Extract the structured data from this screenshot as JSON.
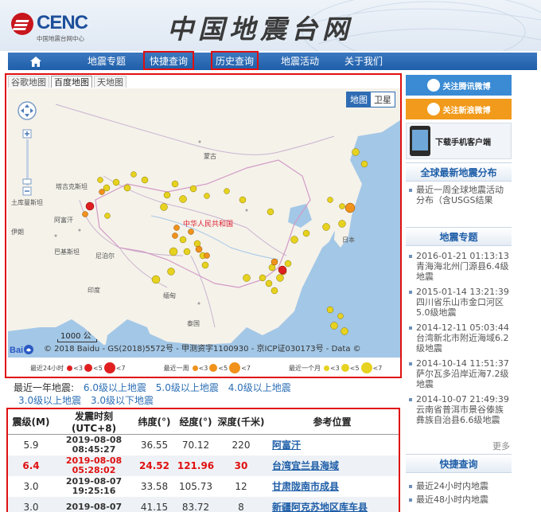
{
  "header": {
    "logo_brand": "CENC",
    "logo_sub": "中国地震台网中心",
    "site_title": "中国地震台网"
  },
  "nav": {
    "home_icon": "home-icon",
    "items": [
      "地震专题",
      "快捷查询",
      "历史查询",
      "地震活动",
      "关于我们"
    ]
  },
  "map": {
    "tabs": [
      "谷歌地图",
      "百度地图",
      "天地图"
    ],
    "active_tab": "百度地图",
    "maptype": [
      "地图",
      "卫星"
    ],
    "scale_label": "1000 公",
    "copyright": "© 2018 Baidu - GS(2018)5572号 - 甲测资字1100930 - 京ICP证030173号 - Data ©",
    "baidu_logo_text": "Bai",
    "country_label": "中华人民共和国",
    "place_labels": [
      "蒙古",
      "阿富汗",
      "土库曼斯坦",
      "伊朗",
      "巴基斯坦",
      "塔吉克斯坦",
      "尼泊尔",
      "印度",
      "缅甸",
      "泰国",
      "日本"
    ],
    "legend": {
      "day": {
        "label": "最近24小时",
        "items": [
          "<3",
          "<5",
          "<7"
        ]
      },
      "week": {
        "label": "最近一周",
        "items": [
          "<3",
          "<5",
          "<7"
        ]
      },
      "month": {
        "label": "最近一个月",
        "items": [
          "<3",
          "<5",
          "<7"
        ]
      }
    },
    "colors": {
      "day": "#e02020",
      "week": "#f0921c",
      "month": "#e6d21f"
    }
  },
  "filters": {
    "label": "最近一年地震:",
    "links": [
      "6.0级以上地震",
      "5.0级以上地震",
      "4.0级以上地震",
      "3.0级以上地震",
      "3.0级以下地震"
    ]
  },
  "table": {
    "headers": [
      "震级(M)",
      "发震时刻(UTC+8)",
      "纬度(°)",
      "经度(°)",
      "深度(千米)",
      "参考位置"
    ],
    "rows": [
      {
        "mag": "5.9",
        "date": "2019-08-08",
        "time": "08:45:27",
        "lat": "36.55",
        "lon": "70.12",
        "depth": "220",
        "loc": "阿富汗"
      },
      {
        "mag": "6.4",
        "date": "2019-08-08",
        "time": "05:28:02",
        "lat": "24.52",
        "lon": "121.96",
        "depth": "30",
        "loc": "台湾宜兰县海域"
      },
      {
        "mag": "3.0",
        "date": "2019-08-07",
        "time": "19:25:16",
        "lat": "33.58",
        "lon": "105.73",
        "depth": "12",
        "loc": "甘肃陇南市成县"
      },
      {
        "mag": "3.0",
        "date": "2019-08-07",
        "time": "",
        "lat": "41.15",
        "lon": "83.72",
        "depth": "8",
        "loc": "新疆阿克苏地区库车县"
      }
    ]
  },
  "sidebar": {
    "tencent": "关注腾讯微博",
    "sina": "关注新浪微博",
    "app": "下载手机客户端",
    "global_head": "全球最新地震分布",
    "global_items": [
      "最近一周全球地震活动分布（含USGS结果"
    ],
    "topic_head": "地震专题",
    "topic_items": [
      "2016-01-21 01:13:13青海海北州门源县6.4级地震",
      "2015-01-14 13:21:39四川省乐山市金口河区5.0级地震",
      "2014-12-11 05:03:44台湾新北市附近海域6.2级地震",
      "2014-10-14 11:51:37萨尔瓦多沿岸近海7.2级地震",
      "2014-10-07 21:49:39云南省普洱市景谷傣族彝族自治县6.6级地震"
    ],
    "more": "更多",
    "quick_head": "快捷查询",
    "quick_items": [
      "最近24小时内地震",
      "最近48小时内地震"
    ]
  }
}
